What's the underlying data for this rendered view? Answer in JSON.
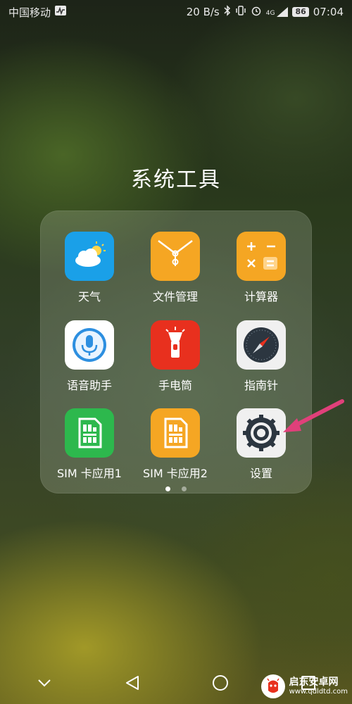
{
  "status_bar": {
    "carrier": "中国移动",
    "speed": "20 B/s",
    "signal": "4G",
    "battery": "86",
    "time": "07:04"
  },
  "folder": {
    "title": "系统工具",
    "apps": [
      {
        "label": "天气",
        "icon": "weather-icon",
        "color": "#1aa0e8"
      },
      {
        "label": "文件管理",
        "icon": "folder-file-icon",
        "color": "#f5a623"
      },
      {
        "label": "计算器",
        "icon": "calculator-icon",
        "color": "#f5a623"
      },
      {
        "label": "语音助手",
        "icon": "microphone-icon",
        "color": "#ffffff"
      },
      {
        "label": "手电筒",
        "icon": "flashlight-icon",
        "color": "#e8301e"
      },
      {
        "label": "指南针",
        "icon": "compass-icon",
        "color": "#f0f0f0"
      },
      {
        "label": "SIM 卡应用1",
        "icon": "sim-card-icon",
        "color": "#2db84d"
      },
      {
        "label": "SIM 卡应用2",
        "icon": "sim-card-icon",
        "color": "#f5a623"
      },
      {
        "label": "设置",
        "icon": "settings-gear-icon",
        "color": "#f0f0f0"
      }
    ],
    "page_count": 2,
    "current_page": 1
  },
  "navigation": {
    "buttons": [
      "collapse-icon",
      "back-icon",
      "home-icon",
      "recents-icon"
    ]
  },
  "watermark": {
    "name": "启东安卓网",
    "url": "www.qdldtd.com"
  },
  "annotation": {
    "arrow_color": "#e0407a"
  }
}
